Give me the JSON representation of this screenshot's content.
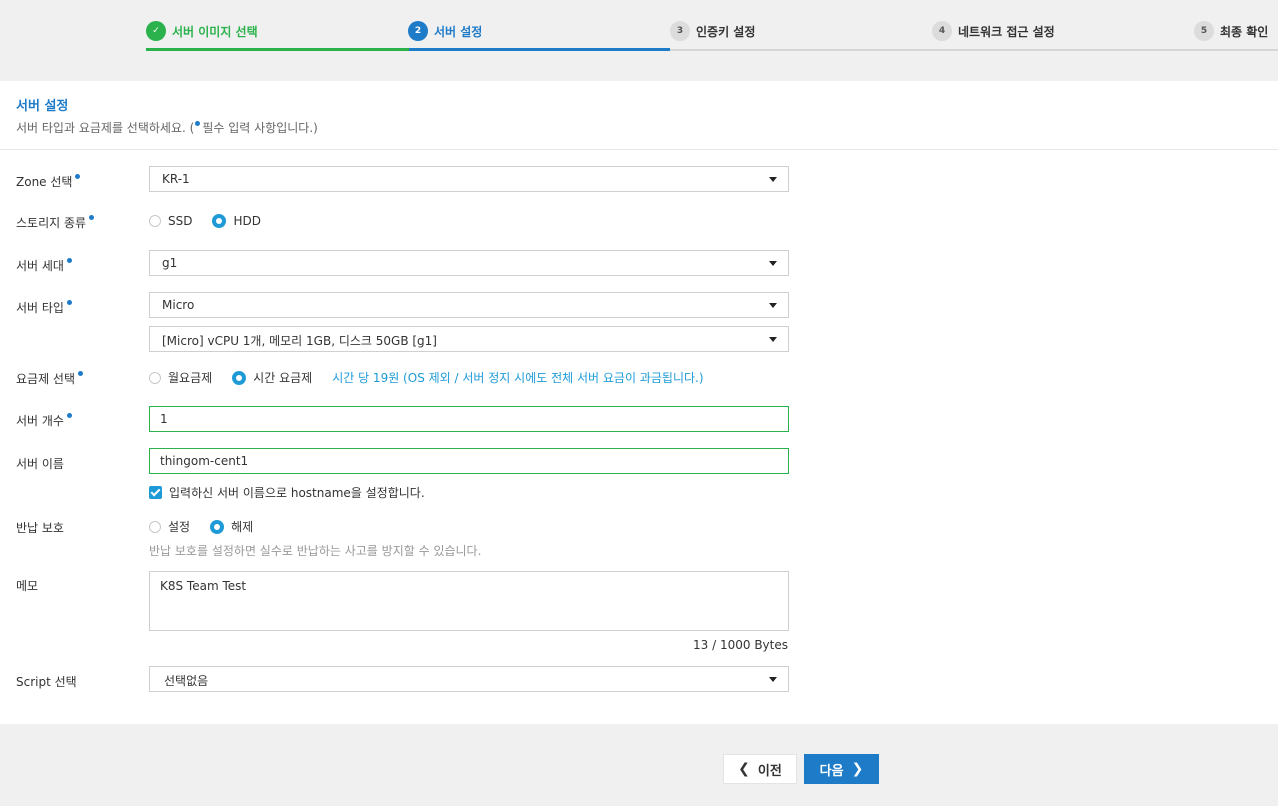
{
  "steps": [
    {
      "num": "✓",
      "label": "서버 이미지 선택",
      "state": "done"
    },
    {
      "num": "2",
      "label": "서버 설정",
      "state": "active"
    },
    {
      "num": "3",
      "label": "인증키 설정",
      "state": "todo"
    },
    {
      "num": "4",
      "label": "네트워크 접근 설정",
      "state": "todo"
    },
    {
      "num": "5",
      "label": "최종 확인",
      "state": "todo"
    }
  ],
  "header": {
    "title": "서버 설정",
    "subtitle_pre": "서버 타입과 요금제를 선택하세요. (",
    "subtitle_post": "필수 입력 사항입니다.)"
  },
  "form": {
    "zone": {
      "label": "Zone 선택",
      "value": "KR-1"
    },
    "storage": {
      "label": "스토리지 종류",
      "options": [
        "SSD",
        "HDD"
      ],
      "selected": "HDD"
    },
    "generation": {
      "label": "서버 세대",
      "value": "g1"
    },
    "server_type": {
      "label": "서버 타입",
      "value": "Micro",
      "spec": "[Micro] vCPU 1개, 메모리 1GB, 디스크 50GB [g1]"
    },
    "pricing": {
      "label": "요금제 선택",
      "options": [
        "월요금제",
        "시간 요금제"
      ],
      "selected": "시간 요금제",
      "note": "시간 당 19원 (OS 제외 / 서버 정지 시에도 전체 서버 요금이 과금됩니다.)"
    },
    "count": {
      "label": "서버 개수",
      "value": "1"
    },
    "name": {
      "label": "서버 이름",
      "value": "thingom-cent1",
      "hostname_check": "입력하신 서버 이름으로 hostname을 설정합니다."
    },
    "protection": {
      "label": "반납 보호",
      "options": [
        "설정",
        "해제"
      ],
      "selected": "해제",
      "hint": "반납 보호를 설정하면 실수로 반납하는 사고를 방지할 수 있습니다."
    },
    "memo": {
      "label": "메모",
      "value": "K8S Team Test",
      "counter": "13 / 1000 Bytes"
    },
    "script": {
      "label": "Script 선택",
      "value": "선택없음"
    }
  },
  "footer": {
    "prev": "이전",
    "next": "다음"
  },
  "colors": {
    "accent": "#1e7bc8",
    "done": "#2bb24c",
    "radio": "#1e9bd7"
  }
}
